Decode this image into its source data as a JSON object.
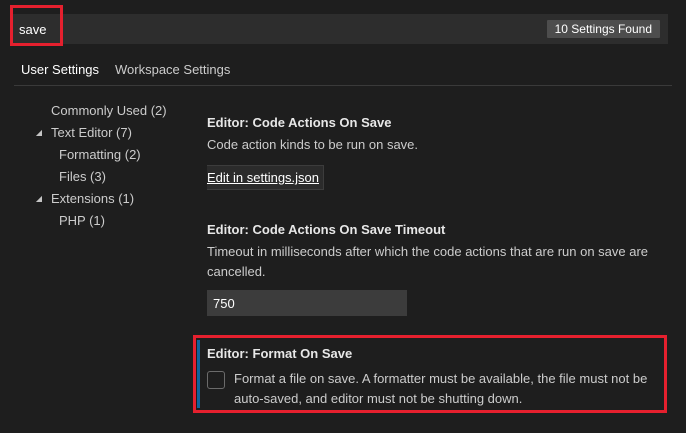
{
  "search": {
    "value": "save",
    "results_badge": "10 Settings Found"
  },
  "tabs": [
    {
      "label": "User Settings",
      "active": true
    },
    {
      "label": "Workspace Settings",
      "active": false
    }
  ],
  "toc": [
    {
      "label": "Commonly Used (2)",
      "level": 0,
      "expanded": null
    },
    {
      "label": "Text Editor (7)",
      "level": 0,
      "expanded": true
    },
    {
      "label": "Formatting (2)",
      "level": 1,
      "expanded": null
    },
    {
      "label": "Files (3)",
      "level": 1,
      "expanded": null
    },
    {
      "label": "Extensions (1)",
      "level": 0,
      "expanded": true
    },
    {
      "label": "PHP (1)",
      "level": 1,
      "expanded": null
    }
  ],
  "settings": {
    "code_actions": {
      "category": "Editor: ",
      "name": "Code Actions On Save",
      "description": "Code action kinds to be run on save.",
      "link_label": "Edit in settings.json"
    },
    "code_actions_timeout": {
      "category": "Editor: ",
      "name": "Code Actions On Save Timeout",
      "description": "Timeout in milliseconds after which the code actions that are run on save are cancelled.",
      "value": "750"
    },
    "format_on_save": {
      "category": "Editor: ",
      "name": "Format On Save",
      "description": "Format a file on save. A formatter must be available, the file must not be auto-saved, and editor must not be shutting down.",
      "checked": false
    }
  },
  "colors": {
    "background": "#1e1e1e",
    "highlight": "#e5202e",
    "focus": "#0e639c"
  },
  "icons": {
    "expanded": "chevron-down-icon"
  }
}
